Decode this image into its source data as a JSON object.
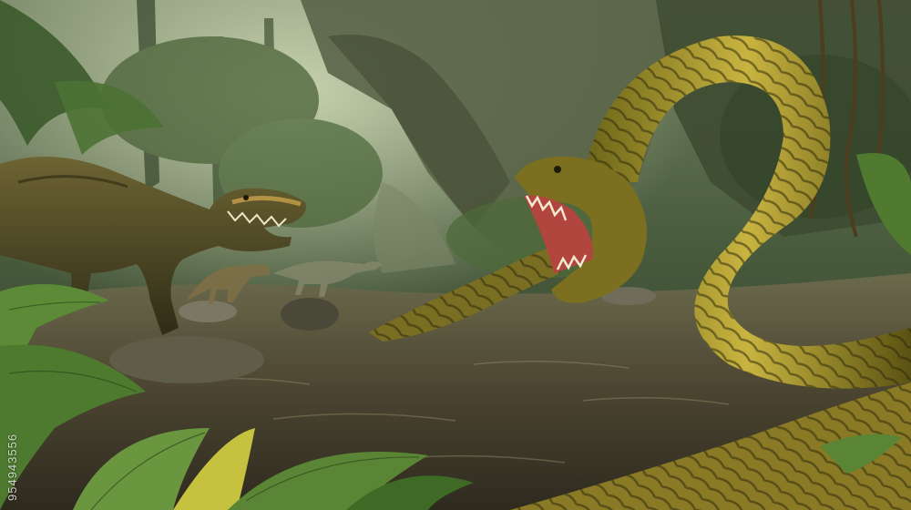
{
  "image": {
    "watermark_id": "954943556"
  },
  "palette": {
    "canopy": "#3d5236",
    "mist": "#9fb08c",
    "water": "#4a4432",
    "serpent": "#b9a53a",
    "serpent_dark": "#3a3410",
    "dino": "#5e5526",
    "leaf": "#5f8a3a"
  }
}
